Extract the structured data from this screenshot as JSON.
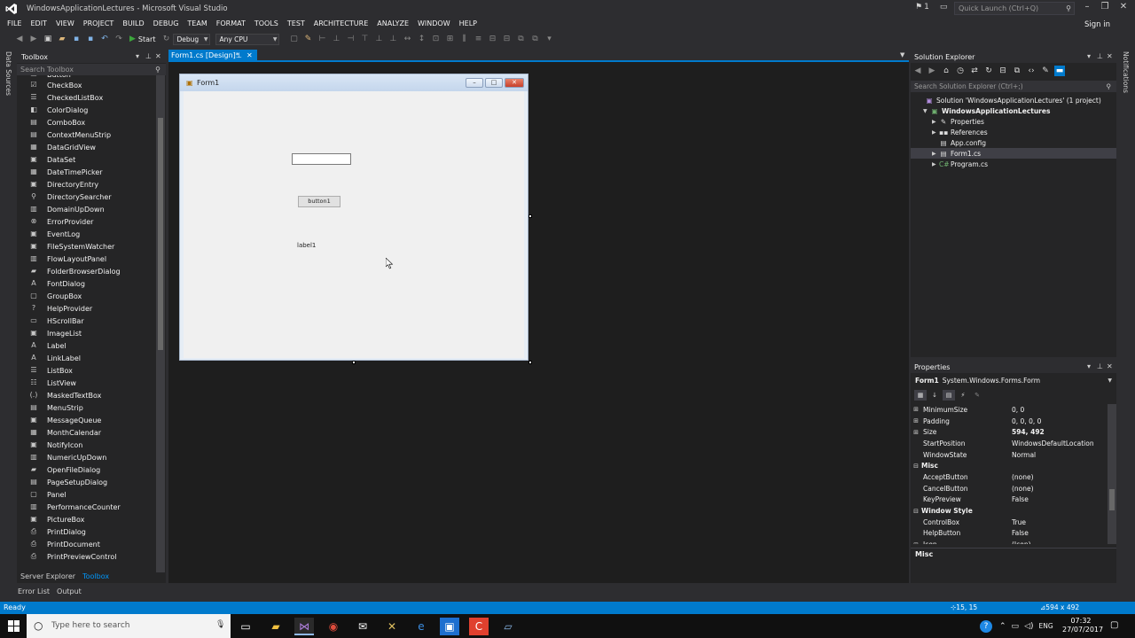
{
  "window": {
    "title": "WindowsApplicationLectures - Microsoft Visual Studio",
    "filter_count": "1",
    "quick_launch_placeholder": "Quick Launch (Ctrl+Q)",
    "sign_in": "Sign in"
  },
  "menu": [
    "FILE",
    "EDIT",
    "VIEW",
    "PROJECT",
    "BUILD",
    "DEBUG",
    "TEAM",
    "FORMAT",
    "TOOLS",
    "TEST",
    "ARCHITECTURE",
    "ANALYZE",
    "WINDOW",
    "HELP"
  ],
  "toolbar": {
    "start_label": "Start",
    "config": "Debug",
    "platform": "Any CPU"
  },
  "side_tabs": {
    "data_sources": "Data Sources",
    "notifications": "Notifications"
  },
  "toolbox": {
    "title": "Toolbox",
    "search_placeholder": "Search Toolbox",
    "items": [
      {
        "label": "Button",
        "icon": "button-icon"
      },
      {
        "label": "CheckBox",
        "icon": "checkbox-icon"
      },
      {
        "label": "CheckedListBox",
        "icon": "checkedlistbox-icon"
      },
      {
        "label": "ColorDialog",
        "icon": "colordialog-icon"
      },
      {
        "label": "ComboBox",
        "icon": "combobox-icon"
      },
      {
        "label": "ContextMenuStrip",
        "icon": "contextmenu-icon"
      },
      {
        "label": "DataGridView",
        "icon": "datagrid-icon"
      },
      {
        "label": "DataSet",
        "icon": "dataset-icon"
      },
      {
        "label": "DateTimePicker",
        "icon": "datetime-icon"
      },
      {
        "label": "DirectoryEntry",
        "icon": "directory-entry-icon"
      },
      {
        "label": "DirectorySearcher",
        "icon": "directory-searcher-icon"
      },
      {
        "label": "DomainUpDown",
        "icon": "domainupdown-icon"
      },
      {
        "label": "ErrorProvider",
        "icon": "errorprovider-icon"
      },
      {
        "label": "EventLog",
        "icon": "eventlog-icon"
      },
      {
        "label": "FileSystemWatcher",
        "icon": "filewatcher-icon"
      },
      {
        "label": "FlowLayoutPanel",
        "icon": "flowlayout-icon"
      },
      {
        "label": "FolderBrowserDialog",
        "icon": "folderbrowser-icon"
      },
      {
        "label": "FontDialog",
        "icon": "fontdialog-icon"
      },
      {
        "label": "GroupBox",
        "icon": "groupbox-icon"
      },
      {
        "label": "HelpProvider",
        "icon": "helpprovider-icon"
      },
      {
        "label": "HScrollBar",
        "icon": "hscrollbar-icon"
      },
      {
        "label": "ImageList",
        "icon": "imagelist-icon"
      },
      {
        "label": "Label",
        "icon": "label-icon"
      },
      {
        "label": "LinkLabel",
        "icon": "linklabel-icon"
      },
      {
        "label": "ListBox",
        "icon": "listbox-icon"
      },
      {
        "label": "ListView",
        "icon": "listview-icon"
      },
      {
        "label": "MaskedTextBox",
        "icon": "maskedtextbox-icon"
      },
      {
        "label": "MenuStrip",
        "icon": "menustrip-icon"
      },
      {
        "label": "MessageQueue",
        "icon": "messagequeue-icon"
      },
      {
        "label": "MonthCalendar",
        "icon": "monthcalendar-icon"
      },
      {
        "label": "NotifyIcon",
        "icon": "notifyicon-icon"
      },
      {
        "label": "NumericUpDown",
        "icon": "numericupdown-icon"
      },
      {
        "label": "OpenFileDialog",
        "icon": "openfiledialog-icon"
      },
      {
        "label": "PageSetupDialog",
        "icon": "pagesetup-icon"
      },
      {
        "label": "Panel",
        "icon": "panel-icon"
      },
      {
        "label": "PerformanceCounter",
        "icon": "perfcounter-icon"
      },
      {
        "label": "PictureBox",
        "icon": "picturebox-icon"
      },
      {
        "label": "PrintDialog",
        "icon": "printdialog-icon"
      },
      {
        "label": "PrintDocument",
        "icon": "printdocument-icon"
      },
      {
        "label": "PrintPreviewControl",
        "icon": "printpreview-icon"
      }
    ],
    "bottom_tabs": [
      "Server Explorer",
      "Toolbox"
    ]
  },
  "document": {
    "tab_label": "Form1.cs [Design]*"
  },
  "form": {
    "title": "Form1",
    "button_text": "button1",
    "label_text": "label1"
  },
  "solution_explorer": {
    "title": "Solution Explorer",
    "search_placeholder": "Search Solution Explorer (Ctrl+;)",
    "tree": [
      {
        "label": "Solution 'WindowsApplicationLectures' (1 project)",
        "level": 0,
        "icon": "solution-icon",
        "arrow": ""
      },
      {
        "label": "WindowsApplicationLectures",
        "level": 1,
        "icon": "csharp-project-icon",
        "arrow": "▼",
        "bold": true
      },
      {
        "label": "Properties",
        "level": 2,
        "icon": "wrench-icon",
        "arrow": "▶"
      },
      {
        "label": "References",
        "level": 2,
        "icon": "references-icon",
        "arrow": "▶"
      },
      {
        "label": "App.config",
        "level": 2,
        "icon": "config-file-icon",
        "arrow": ""
      },
      {
        "label": "Form1.cs",
        "level": 2,
        "icon": "form-file-icon",
        "arrow": "▶",
        "selected": true
      },
      {
        "label": "Program.cs",
        "level": 2,
        "icon": "csharp-file-icon",
        "arrow": "▶"
      }
    ]
  },
  "properties": {
    "title": "Properties",
    "object_name": "Form1",
    "object_type": "System.Windows.Forms.Form",
    "rows": [
      {
        "name": "MinimumSize",
        "value": "0, 0",
        "exp": "⊞"
      },
      {
        "name": "Padding",
        "value": "0, 0, 0, 0",
        "exp": "⊞"
      },
      {
        "name": "Size",
        "value": "594, 492",
        "exp": "⊞",
        "bold_value": true
      },
      {
        "name": "StartPosition",
        "value": "WindowsDefaultLocation",
        "exp": ""
      },
      {
        "name": "WindowState",
        "value": "Normal",
        "exp": ""
      },
      {
        "name": "Misc",
        "value": "",
        "exp": "⊟",
        "category": true
      },
      {
        "name": "AcceptButton",
        "value": "(none)",
        "exp": ""
      },
      {
        "name": "CancelButton",
        "value": "(none)",
        "exp": ""
      },
      {
        "name": "KeyPreview",
        "value": "False",
        "exp": ""
      },
      {
        "name": "Window Style",
        "value": "",
        "exp": "⊟",
        "category": true
      },
      {
        "name": "ControlBox",
        "value": "True",
        "exp": ""
      },
      {
        "name": "HelpButton",
        "value": "False",
        "exp": ""
      },
      {
        "name": "Icon",
        "value": "(Icon)",
        "exp": "⊞"
      }
    ],
    "description": "Misc"
  },
  "bottom_tool_tabs": [
    "Error List",
    "Output"
  ],
  "status": {
    "text": "Ready",
    "position": "15, 15",
    "size": "594 x 492"
  },
  "taskbar": {
    "search_placeholder": "Type here to search",
    "language": "ENG",
    "time": "07:32",
    "date": "27/07/2017"
  }
}
